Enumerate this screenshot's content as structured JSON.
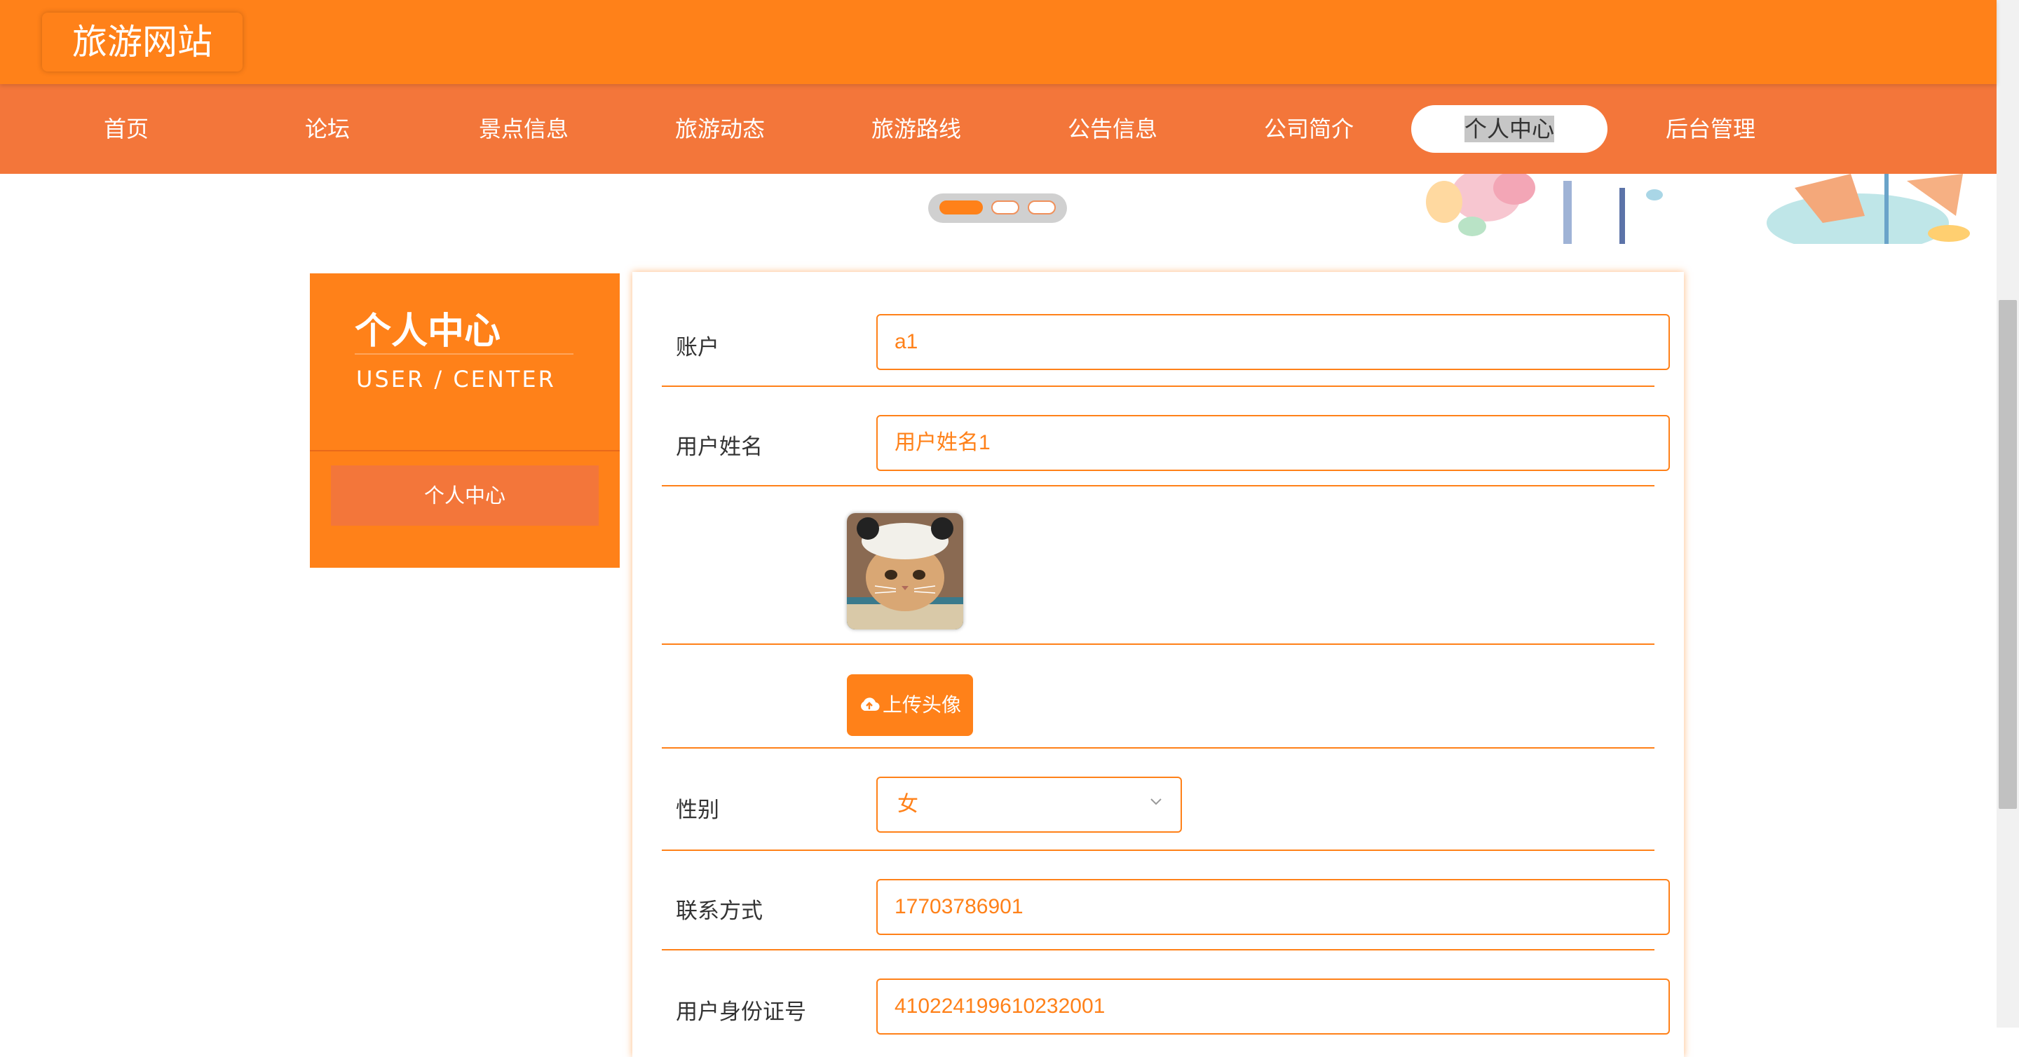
{
  "site": {
    "title": "旅游网站"
  },
  "nav": {
    "items": [
      {
        "label": "首页"
      },
      {
        "label": "论坛"
      },
      {
        "label": "景点信息"
      },
      {
        "label": "旅游动态"
      },
      {
        "label": "旅游路线"
      },
      {
        "label": "公告信息"
      },
      {
        "label": "公司简介"
      },
      {
        "label": "个人中心",
        "active": true
      },
      {
        "label": "后台管理"
      }
    ]
  },
  "banner": {
    "slide_count": 3,
    "active_slide": 1
  },
  "side": {
    "title": "个人中心",
    "subtitle": "USER / CENTER",
    "menu_button": "个人中心"
  },
  "form": {
    "account": {
      "label": "账户",
      "value": "a1"
    },
    "username": {
      "label": "用户姓名",
      "value": "用户姓名1"
    },
    "avatar": {
      "icon": "cat-photo"
    },
    "upload": {
      "label": "上传头像",
      "icon": "cloud-upload-icon"
    },
    "gender": {
      "label": "性别",
      "value": "女"
    },
    "phone": {
      "label": "联系方式",
      "value": "17703786901"
    },
    "id_number": {
      "label": "用户身份证号",
      "value": "410224199610232001"
    }
  },
  "colors": {
    "primary": "#ff8119",
    "nav": "#f3763a"
  }
}
